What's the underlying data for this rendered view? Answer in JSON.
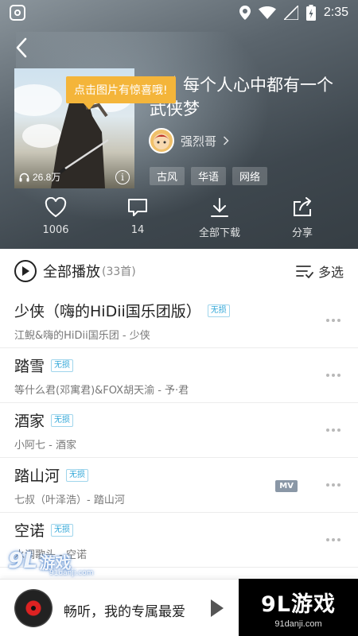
{
  "status_bar": {
    "time": "2:35"
  },
  "cover": {
    "tooltip": "点击图片有惊喜哦!",
    "play_count": "26.8万"
  },
  "playlist": {
    "title": "风｜每个人心中都有一个武侠梦",
    "creator": "强烈哥",
    "tags": [
      "古风",
      "华语",
      "网络"
    ]
  },
  "actions": [
    {
      "label": "1006",
      "icon": "heart-icon"
    },
    {
      "label": "14",
      "icon": "comment-icon"
    },
    {
      "label": "全部下载",
      "icon": "download-icon"
    },
    {
      "label": "分享",
      "icon": "share-icon"
    }
  ],
  "play_all": {
    "label": "全部播放",
    "count": "(33首)",
    "multi_select": "多选"
  },
  "songs": [
    {
      "title": "少侠（嗨的HiDii国乐团版）",
      "badge": "无损",
      "subtitle": "江鲵&嗨的HiDii国乐团 - 少侠"
    },
    {
      "title": "踏雪",
      "badge": "无损",
      "subtitle": "等什么君(邓寓君)&FOX胡天渝 - 予·君"
    },
    {
      "title": "酒家",
      "badge": "无损",
      "subtitle": "小阿七 - 酒家"
    },
    {
      "title": "踏山河",
      "badge": "无损",
      "subtitle": "七叔（叶泽浩）- 踏山河",
      "mv": "MV"
    },
    {
      "title": "空诺",
      "badge": "无损",
      "subtitle": "水调歌头 - 空诺"
    }
  ],
  "player": {
    "text": "畅听，我的专属最爱"
  },
  "watermark": {
    "logo": "9L游戏",
    "site": "91danji.com",
    "overlay_big": "9L",
    "overlay_text": "游戏",
    "overlay_url": "91danji.com"
  },
  "colors": {
    "accent": "#f4b53a",
    "lossless": "#31a7d8",
    "mv": "#8a97a6"
  }
}
